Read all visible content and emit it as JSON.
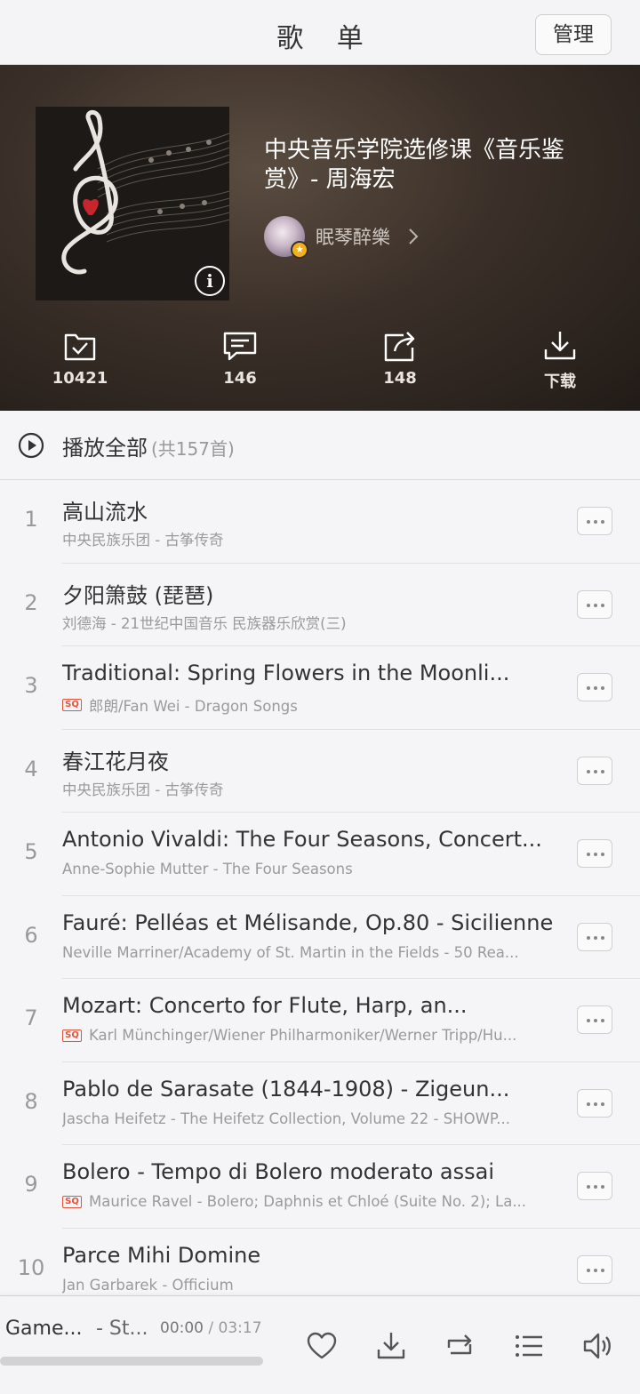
{
  "navbar": {
    "title": "歌 单",
    "manage_label": "管理"
  },
  "playlist": {
    "title": "中央音乐学院选修课《音乐鉴赏》- 周海宏",
    "creator": "眠琴醉樂",
    "actions": [
      {
        "icon": "collect-check-icon",
        "label": "10421"
      },
      {
        "icon": "comment-icon",
        "label": "146"
      },
      {
        "icon": "share-icon",
        "label": "148"
      },
      {
        "icon": "download-icon",
        "label": "下载"
      }
    ]
  },
  "play_all": {
    "label": "播放全部",
    "count": "(共157首)"
  },
  "songs": [
    {
      "num": "1",
      "title": "高山流水",
      "sub": "中央民族乐团 - 古筝传奇",
      "sq": false
    },
    {
      "num": "2",
      "title": "夕阳箫鼓 (琵琶)",
      "sub": "刘德海 - 21世纪中国音乐 民族器乐欣赏(三)",
      "sq": false
    },
    {
      "num": "3",
      "title": "Traditional: Spring Flowers in the Moonli...",
      "sub": "郎朗/Fan Wei - Dragon Songs",
      "sq": true
    },
    {
      "num": "4",
      "title": "春江花月夜",
      "sub": "中央民族乐团 - 古筝传奇",
      "sq": false
    },
    {
      "num": "5",
      "title": "Antonio Vivaldi: The Four Seasons, Concert...",
      "sub": "Anne-Sophie Mutter - The Four Seasons",
      "sq": false
    },
    {
      "num": "6",
      "title": "Fauré: Pelléas et Mélisande, Op.80 - Sicilienne",
      "sub": "Neville Marriner/Academy of St. Martin in the Fields - 50 Rea...",
      "sq": false
    },
    {
      "num": "7",
      "title": "Mozart: Concerto for Flute, Harp, an...",
      "sub": "Karl Münchinger/Wiener Philharmoniker/Werner Tripp/Hu...",
      "sq": true
    },
    {
      "num": "8",
      "title": "Pablo de Sarasate (1844-1908) - Zigeun...",
      "sub": "Jascha Heifetz - The Heifetz Collection, Volume 22 - SHOWP...",
      "sq": false
    },
    {
      "num": "9",
      "title": "Bolero - Tempo di Bolero moderato assai",
      "sub": "Maurice Ravel - Bolero; Daphnis et Chloé (Suite No. 2); La...",
      "sq": true
    },
    {
      "num": "10",
      "title": "Parce Mihi Domine",
      "sub": "Jan Garbarek - Officium",
      "sq": false
    }
  ],
  "sq_tag": "SQ",
  "player": {
    "title": "Game...",
    "artist": "- St...",
    "elapsed": "00:00",
    "separator": " / ",
    "duration": "03:17",
    "progress": 0,
    "controls": [
      "heart-icon",
      "download-icon",
      "repeat-icon",
      "playlist-icon",
      "volume-icon"
    ]
  },
  "colors": {
    "accent": "#e2553c",
    "header_dark": "#2a221d"
  }
}
